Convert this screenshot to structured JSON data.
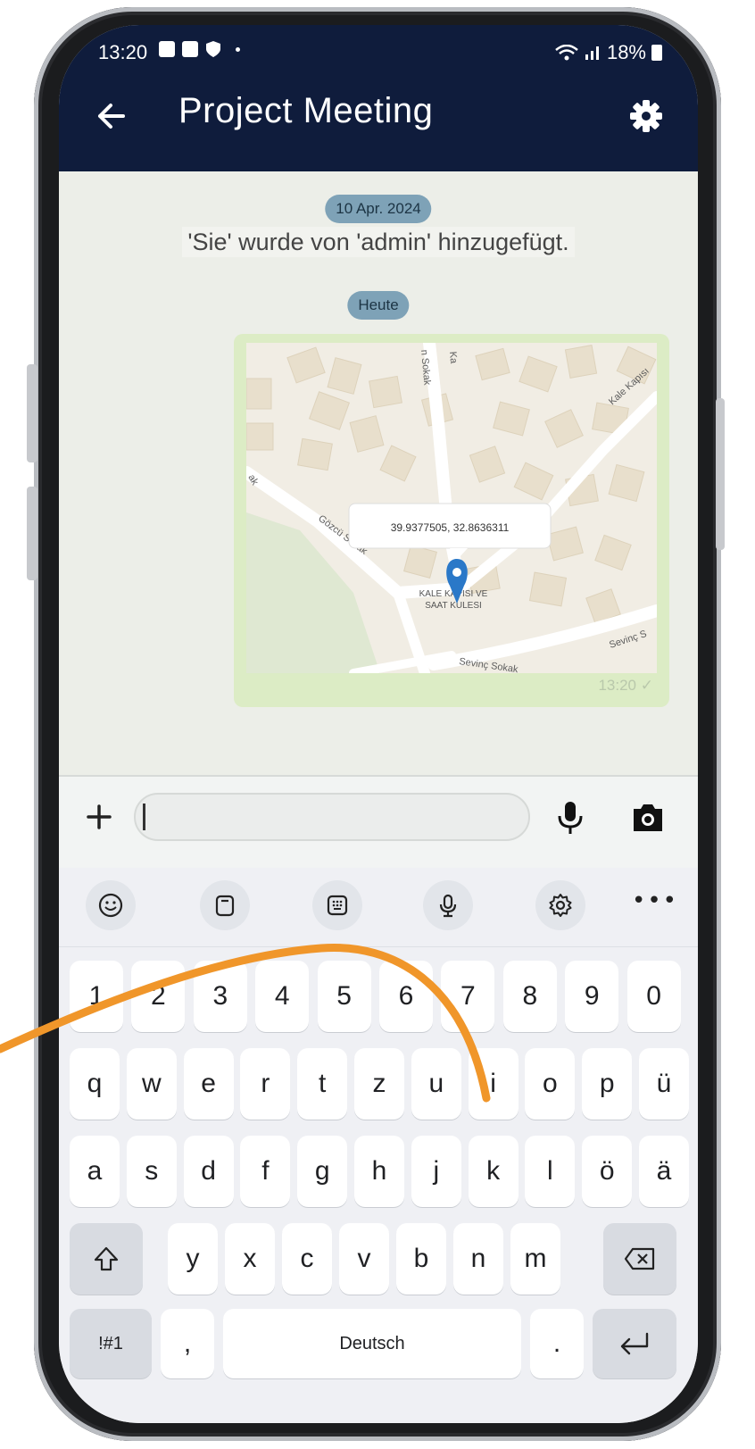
{
  "statusbar": {
    "time": "13:20",
    "battery": "18%"
  },
  "header": {
    "title": "Project Meeting"
  },
  "chat": {
    "date_chip_1": "10 Apr. 2024",
    "system_message": "'Sie' wurde von 'admin' hinzugefügt.",
    "date_chip_2": "Heute",
    "location_message": {
      "coordinates": "39.9377505, 32.8636311",
      "place_line1": "KALE KAPISI VE",
      "place_line2": "SAAT KULESI",
      "streets": [
        "Gözcü Sokak",
        "Sevinç Sokak",
        "Kale Kapısı",
        "Sevinç S",
        "n Sokak",
        "Ka",
        "ak"
      ],
      "time": "13:20",
      "status": "✓"
    }
  },
  "composer": {
    "input_value": "",
    "placeholder": ""
  },
  "keyboard": {
    "row_numbers": [
      "1",
      "2",
      "3",
      "4",
      "5",
      "6",
      "7",
      "8",
      "9",
      "0"
    ],
    "row_1": [
      "q",
      "w",
      "e",
      "r",
      "t",
      "z",
      "u",
      "i",
      "o",
      "p",
      "ü"
    ],
    "row_2": [
      "a",
      "s",
      "d",
      "f",
      "g",
      "h",
      "j",
      "k",
      "l",
      "ö",
      "ä"
    ],
    "row_3": [
      "y",
      "x",
      "c",
      "v",
      "b",
      "n",
      "m"
    ],
    "symbols_label": "!#1",
    "comma": ",",
    "space_label": "Deutsch",
    "period": ".",
    "more_label": "•••"
  },
  "colors": {
    "header_bg": "#0f1c3c",
    "bubble_bg": "#dcecc5",
    "date_chip_bg": "#7ea2b7",
    "swipe_trail": "#f0962a",
    "map_pin": "#2a78c8"
  }
}
